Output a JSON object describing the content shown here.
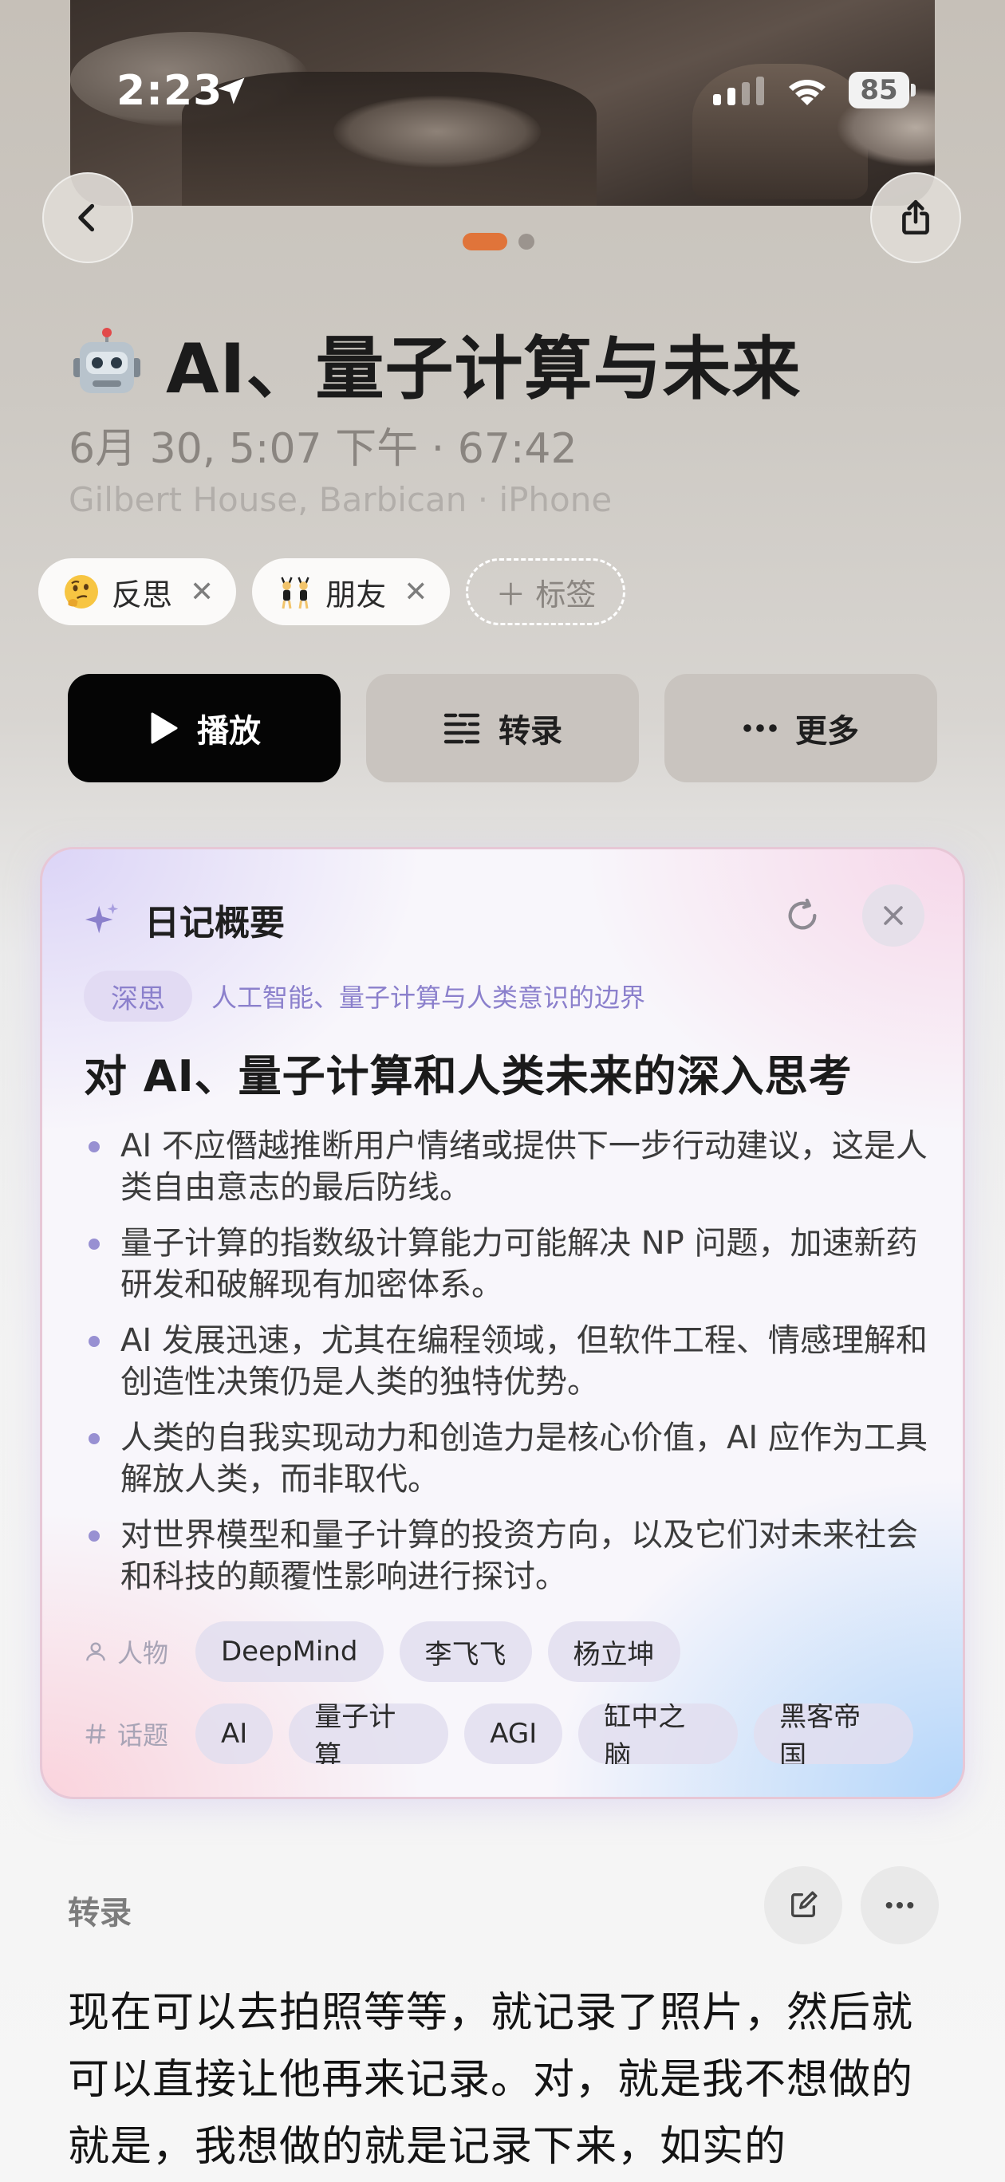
{
  "status_bar": {
    "time": "2:23",
    "battery": "85"
  },
  "colors": {
    "pager_active": "#e0743a",
    "play_button": "#050505",
    "accent_purple": "#8b80cc"
  },
  "pager": {
    "count": 2,
    "active": 0
  },
  "header": {
    "title": "AI、量子计算与未来",
    "emoji_name": "robot-face-icon",
    "datetime_duration": "6月 30, 5:07 下午 · 67:42",
    "location_device": "Gilbert House, Barbican · iPhone"
  },
  "tags": [
    {
      "emoji_name": "thinking-face-icon",
      "label": "反思"
    },
    {
      "emoji_name": "dancing-people-icon",
      "label": "朋友"
    }
  ],
  "add_tag_label": "标签",
  "actions": {
    "play": "播放",
    "transcribe": "转录",
    "more": "更多"
  },
  "summary": {
    "title": "日记概要",
    "category": "深思",
    "category_detail": "人工智能、量子计算与人类意识的边界",
    "headline": "对 AI、量子计算和人类未来的深入思考",
    "bullets": [
      "AI 不应僭越推断用户情绪或提供下一步行动建议，这是人类自由意志的最后防线。",
      "量子计算的指数级计算能力可能解决 NP 问题，加速新药研发和破解现有加密体系。",
      "AI 发展迅速，尤其在编程领域，但软件工程、情感理解和创造性决策仍是人类的独特优势。",
      "人类的自我实现动力和创造力是核心价值，AI 应作为工具解放人类，而非取代。",
      "对世界模型和量子计算的投资方向，以及它们对未来社会和科技的颠覆性影响进行探讨。"
    ],
    "people_label": "人物",
    "people": [
      "DeepMind",
      "李飞飞",
      "杨立坤"
    ],
    "topics_label": "话题",
    "topics": [
      "AI",
      "量子计算",
      "AGI",
      "缸中之脑",
      "黑客帝国"
    ]
  },
  "transcript": {
    "heading": "转录",
    "text": "现在可以去拍照等等，就记录了照片，然后就可以直接让他再来记录。对，就是我不想做的就是，我想做的就是记录下来，如实的"
  }
}
